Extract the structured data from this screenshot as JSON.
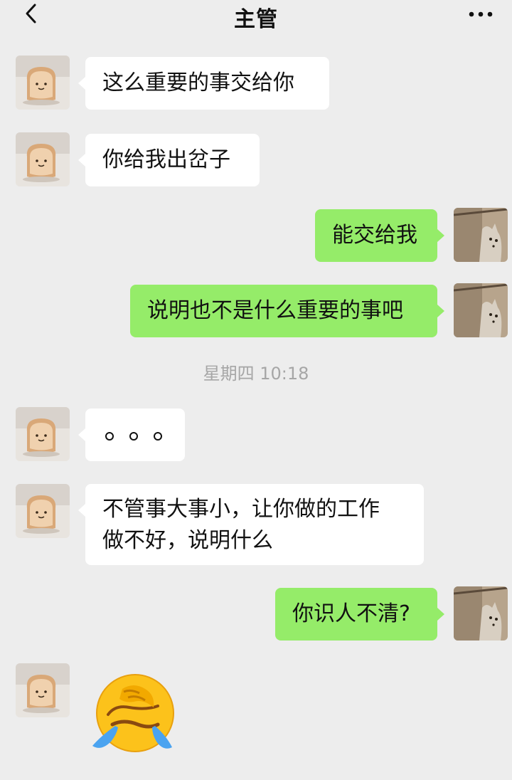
{
  "header": {
    "title": "主管"
  },
  "messages": {
    "m1": "这么重要的事交给你",
    "m2": "你给我出岔子",
    "m3": "能交给我",
    "m4": "说明也不是什么重要的事吧",
    "m6_line1": "不管事大事小，让你做的工作",
    "m6_line2": "做不好，说明什么",
    "m7": "你识人不清?"
  },
  "timestamp": "星期四 10:18",
  "icons": {
    "back": "chevron-left-icon",
    "more": "more-dots-icon",
    "emoji": "facepalm-crying-emoji"
  }
}
